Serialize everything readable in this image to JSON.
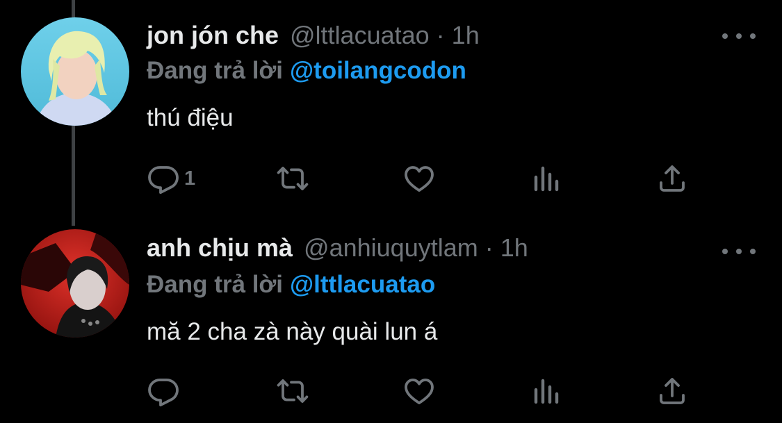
{
  "colors": {
    "background": "#000000",
    "primary_text": "#e7e9ea",
    "secondary_text": "#71767b",
    "accent": "#1d9bf0",
    "thread_line": "#3e4144"
  },
  "tweets": [
    {
      "name": "jon jón che",
      "handle": "@lttlacuatao",
      "separator": "·",
      "time": "1h",
      "reply_prefix": "Đang trả lời",
      "reply_to": "@toilangcodon",
      "text": "thú điệu",
      "reply_count": "1",
      "icons": [
        "reply-icon",
        "retweet-icon",
        "like-icon",
        "views-icon",
        "share-icon",
        "more-icon"
      ]
    },
    {
      "name": "anh chịu mà",
      "handle": "@anhiuquytlam",
      "separator": "·",
      "time": "1h",
      "reply_prefix": "Đang trả lời",
      "reply_to": "@lttlacuatao",
      "text": "mă 2 cha zà này quài lun á",
      "reply_count": "",
      "icons": [
        "reply-icon",
        "retweet-icon",
        "like-icon",
        "views-icon",
        "share-icon",
        "more-icon"
      ]
    }
  ]
}
